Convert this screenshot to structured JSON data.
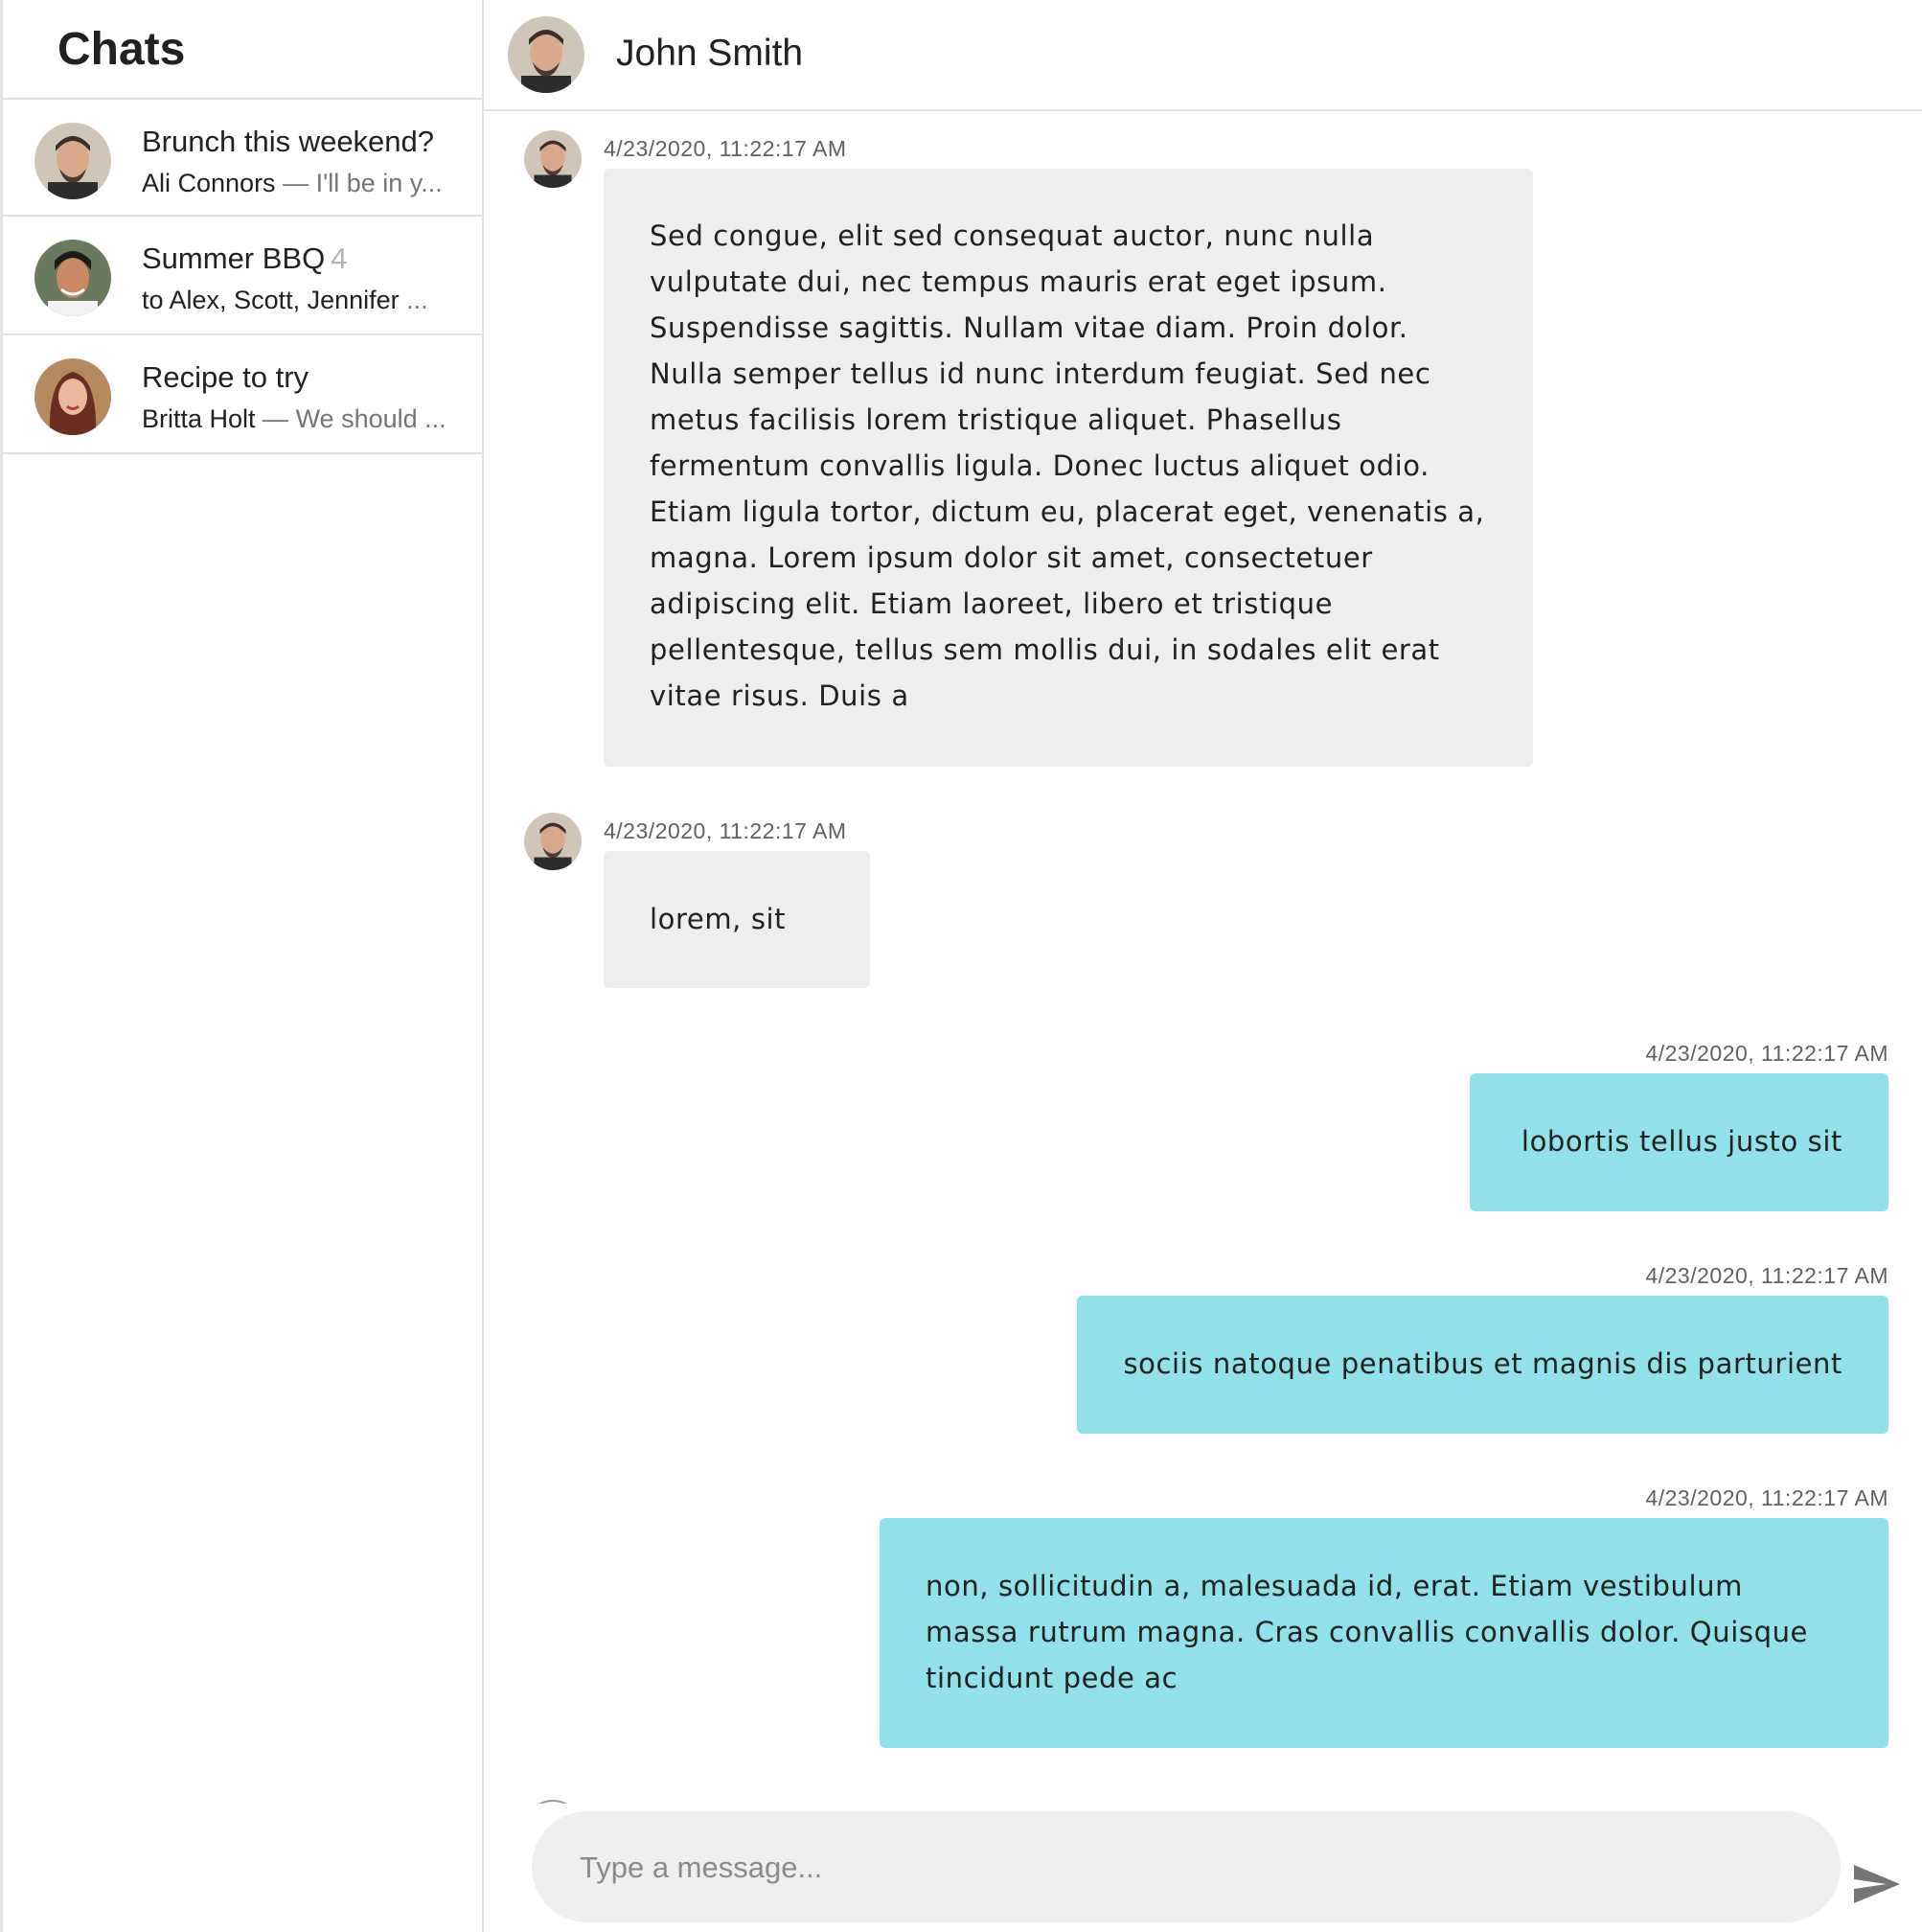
{
  "sidebar": {
    "title": "Chats",
    "conversations": [
      {
        "title": "Brunch this weekend?",
        "count": "",
        "from": "Ali Connors",
        "separator": " — ",
        "preview": "I'll be in y..."
      },
      {
        "title": "Summer BBQ",
        "count": "4",
        "from": "to Alex, Scott, Jennifer",
        "separator": " ",
        "preview": "..."
      },
      {
        "title": "Recipe to try",
        "count": "",
        "from": "Britta Holt",
        "separator": " — ",
        "preview": "We should ..."
      }
    ]
  },
  "chat": {
    "contact_name": "John Smith",
    "messages": [
      {
        "direction": "incoming",
        "time": "4/23/2020, 11:22:17 AM",
        "text": "Sed congue, elit sed consequat auctor, nunc nulla vulputate dui, nec tempus mauris erat eget ipsum. Suspendisse sagittis. Nullam vitae diam. Proin dolor. Nulla semper tellus id nunc interdum feugiat. Sed nec metus facilisis lorem tristique aliquet. Phasellus fermentum convallis ligula. Donec luctus aliquet odio. Etiam ligula tortor, dictum eu, placerat eget, venenatis a, magna. Lorem ipsum dolor sit amet, consectetuer adipiscing elit. Etiam laoreet, libero et tristique pellentesque, tellus sem mollis dui, in sodales elit erat vitae risus. Duis a"
      },
      {
        "direction": "incoming",
        "time": "4/23/2020, 11:22:17 AM",
        "text": "lorem, sit"
      },
      {
        "direction": "outgoing",
        "time": "4/23/2020, 11:22:17 AM",
        "text": "lobortis tellus justo sit"
      },
      {
        "direction": "outgoing",
        "time": "4/23/2020, 11:22:17 AM",
        "text": "sociis natoque penatibus et magnis dis parturient"
      },
      {
        "direction": "outgoing",
        "time": "4/23/2020, 11:22:17 AM",
        "text": "non, sollicitudin a, malesuada id, erat. Etiam vestibulum massa rutrum magna. Cras convallis convallis dolor. Quisque tincidunt pede ac"
      }
    ],
    "composer_placeholder": "Type a message..."
  },
  "icons": {
    "send": "send-icon"
  },
  "colors": {
    "incoming_bubble": "#eeeeee",
    "outgoing_bubble": "#91e0ea",
    "divider": "#e0e0e0"
  }
}
